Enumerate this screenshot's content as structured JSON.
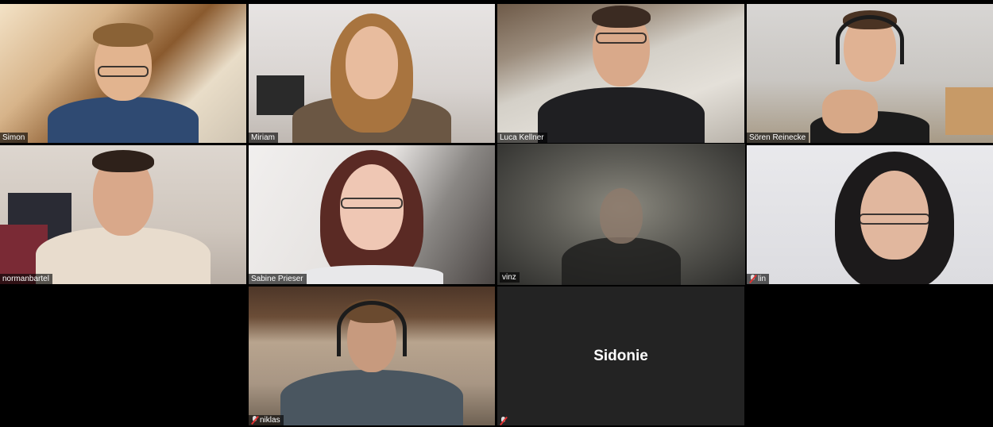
{
  "participants": [
    {
      "name": "Simon",
      "muted": false
    },
    {
      "name": "Miriam",
      "muted": false
    },
    {
      "name": "Luca Kellner",
      "muted": false
    },
    {
      "name": "Sören Reinecke",
      "muted": false
    },
    {
      "name": "normanbartel",
      "muted": false
    },
    {
      "name": "Sabine Prieser",
      "muted": false
    },
    {
      "name": "vinz",
      "muted": false,
      "active_speaker": true
    },
    {
      "name": "lin",
      "muted": true
    },
    {
      "name": "niklas",
      "muted": true
    },
    {
      "name": "",
      "muted": true,
      "video_off_label": "Sidonie"
    }
  ],
  "colors": {
    "active_border": "#d7f26b",
    "tile_off_bg": "#232323",
    "mute_red": "#e03131"
  }
}
